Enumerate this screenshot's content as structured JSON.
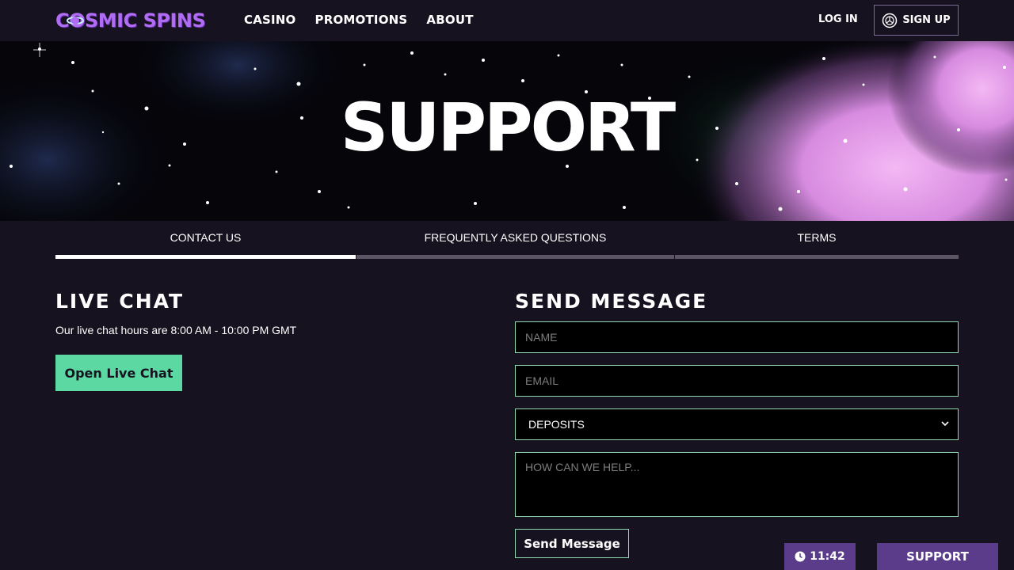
{
  "header": {
    "logo": "COSMIC SPINS",
    "nav": [
      {
        "label": "CASINO"
      },
      {
        "label": "PROMOTIONS"
      },
      {
        "label": "ABOUT"
      }
    ],
    "login_label": "LOG IN",
    "signup_label": "SIGN UP"
  },
  "hero": {
    "title": "SUPPORT"
  },
  "tabs": [
    {
      "label": "CONTACT US",
      "active": true
    },
    {
      "label": "FREQUENTLY ASKED QUESTIONS",
      "active": false
    },
    {
      "label": "TERMS",
      "active": false
    }
  ],
  "live_chat": {
    "title": "LIVE CHAT",
    "hours": "Our live chat hours are 8:00 AM - 10:00 PM GMT",
    "button_label": "Open Live Chat"
  },
  "send_message": {
    "title": "SEND MESSAGE",
    "name_placeholder": "NAME",
    "email_placeholder": "EMAIL",
    "topic_selected": "DEPOSITS",
    "message_placeholder": "HOW CAN WE HELP...",
    "button_label": "Send Message"
  },
  "footer": {
    "clock": "11:42",
    "support_label": "SUPPORT"
  },
  "colors": {
    "background": "#17121f",
    "accent_green": "#5cd9a2",
    "field_border": "#8fd9b3",
    "purple_tab": "#5b3c8a",
    "logo_purple": "#b06cf2"
  },
  "icons": {
    "signup": "wheel-icon",
    "clock": "clock-icon",
    "select": "chevron-down-icon"
  }
}
